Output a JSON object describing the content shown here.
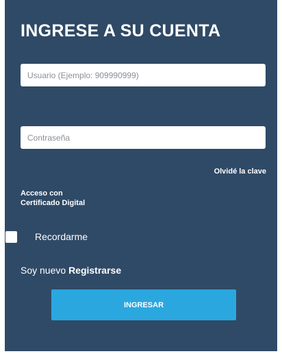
{
  "login": {
    "title": "INGRESE A SU CUENTA",
    "username_placeholder": "Usuario (Ejemplo: 909990999)",
    "password_placeholder": "Contraseña",
    "forgot_label": "Olvidé la clave",
    "cert_line1": "Acceso con",
    "cert_line2": "Certificado Digital",
    "remember_label": "Recordarme",
    "new_user_text": "Soy nuevo ",
    "register_label": "Registrarse",
    "submit_label": "INGRESAR"
  },
  "colors": {
    "panel_background": "#2f4a66",
    "button_background": "#2ba7e0",
    "text": "#ffffff"
  }
}
